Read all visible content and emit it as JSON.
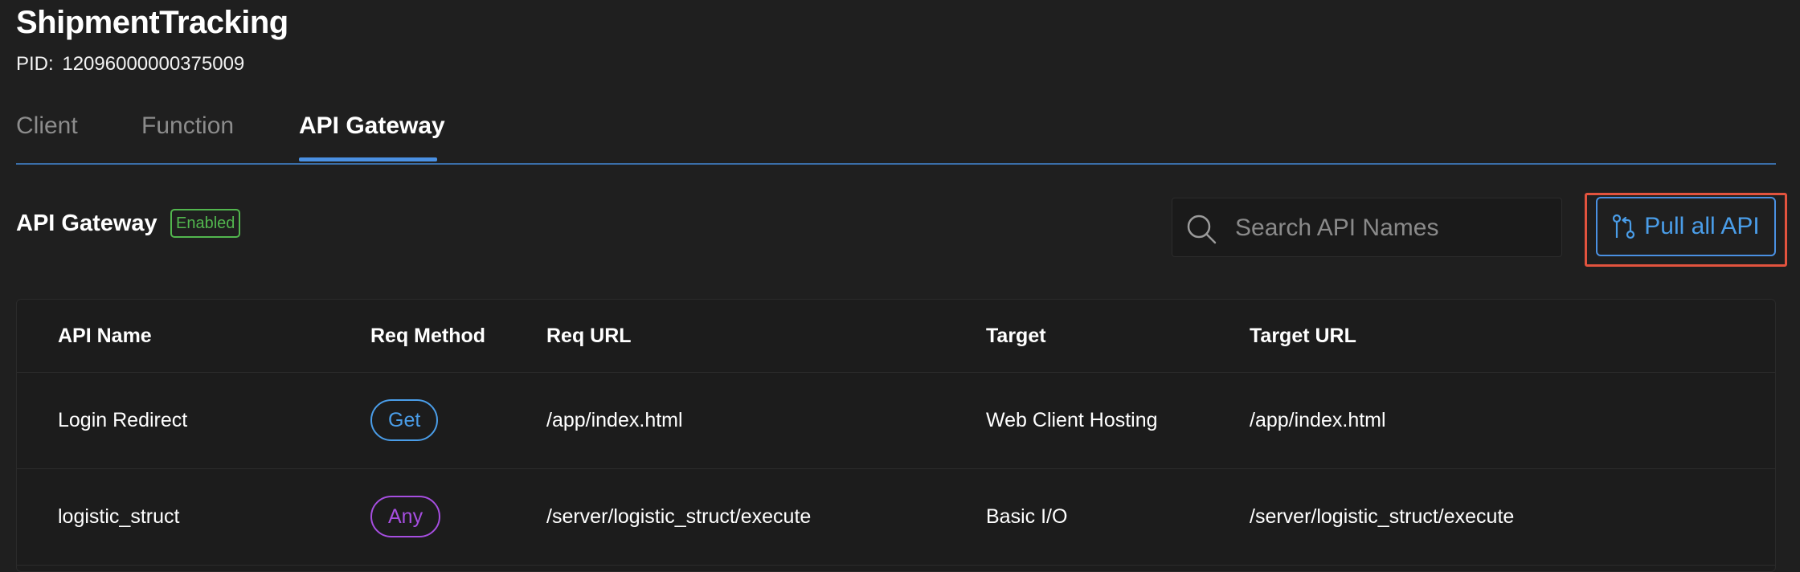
{
  "app": {
    "title": "ShipmentTracking",
    "pid_label": "PID:",
    "pid_value": "12096000000375009"
  },
  "tabs": [
    {
      "label": "Client",
      "active": false
    },
    {
      "label": "Function",
      "active": false
    },
    {
      "label": "API Gateway",
      "active": true
    }
  ],
  "section": {
    "title": "API Gateway",
    "status": "Enabled"
  },
  "search": {
    "placeholder": "Search API Names",
    "value": ""
  },
  "toolbar": {
    "pull_all_label": "Pull all API"
  },
  "table": {
    "columns": [
      "API Name",
      "Req Method",
      "Req URL",
      "Target",
      "Target URL"
    ],
    "rows": [
      {
        "api_name": "Login Redirect",
        "method": "Get",
        "req_url": "/app/index.html",
        "target": "Web Client Hosting",
        "target_url": "/app/index.html"
      },
      {
        "api_name": "logistic_struct",
        "method": "Any",
        "req_url": "/server/logistic_struct/execute",
        "target": "Basic I/O",
        "target_url": "/server/logistic_struct/execute"
      }
    ]
  },
  "colors": {
    "background": "#1f1f1f",
    "accent_blue": "#4a90e2",
    "enabled_green": "#52b64e",
    "highlight_red": "#e2533e",
    "method_get": "#4a9de8",
    "method_any": "#a64ee0"
  }
}
